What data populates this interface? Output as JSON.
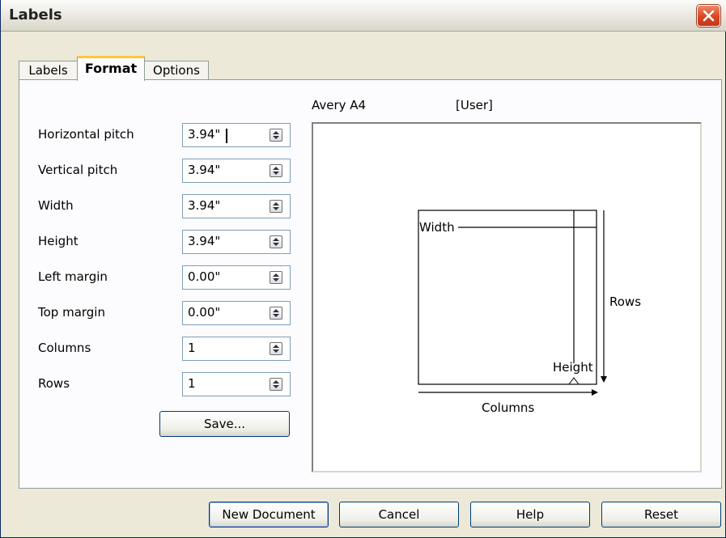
{
  "window": {
    "title": "Labels"
  },
  "tabs": [
    {
      "label": "Labels"
    },
    {
      "label": "Format"
    },
    {
      "label": "Options"
    }
  ],
  "fields": [
    {
      "label": "Horizontal pitch",
      "value": "3.94\""
    },
    {
      "label": "Vertical pitch",
      "value": "3.94\""
    },
    {
      "label": "Width",
      "value": "3.94\""
    },
    {
      "label": "Height",
      "value": "3.94\""
    },
    {
      "label": "Left margin",
      "value": "0.00\""
    },
    {
      "label": "Top margin",
      "value": "0.00\""
    },
    {
      "label": "Columns",
      "value": "1"
    },
    {
      "label": "Rows",
      "value": "1"
    }
  ],
  "save_button": "Save...",
  "preview": {
    "brand": "Avery A4",
    "type": "[User]",
    "width_label": "Width",
    "height_label": "Height",
    "rows_label": "Rows",
    "columns_label": "Columns"
  },
  "buttons": {
    "new_document": "New Document",
    "cancel": "Cancel",
    "help": "Help",
    "reset": "Reset"
  }
}
